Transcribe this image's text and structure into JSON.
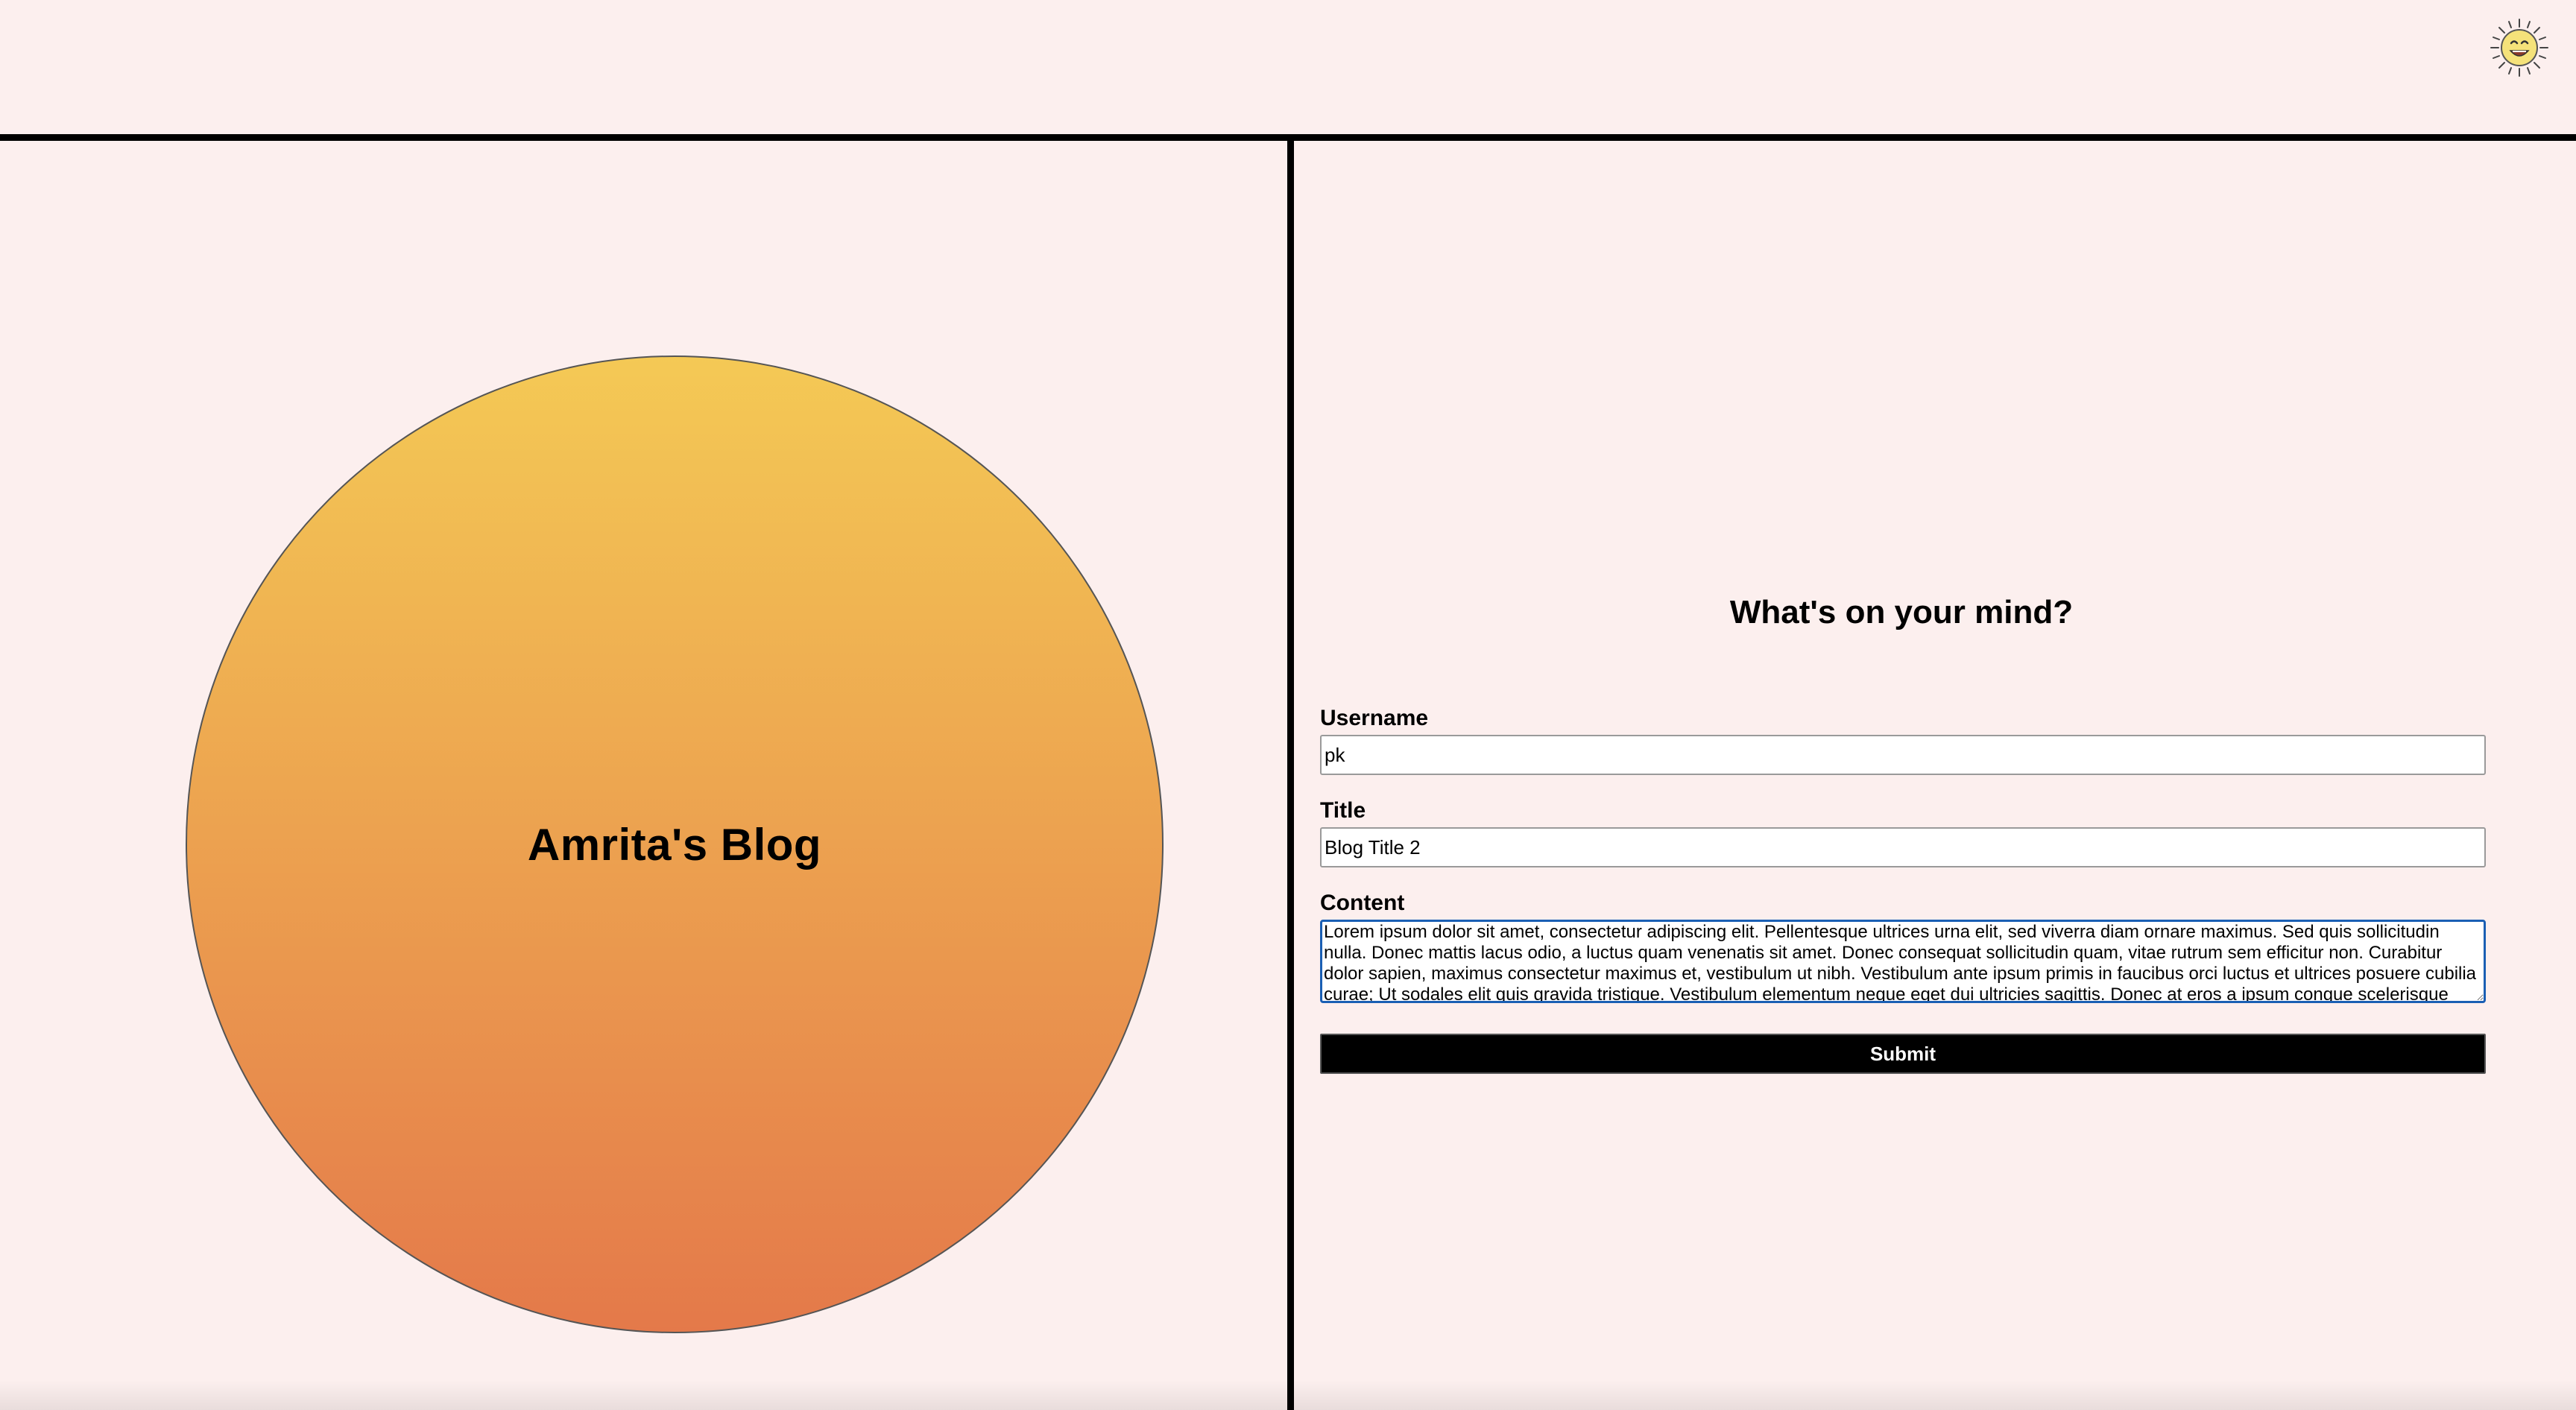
{
  "header": {
    "theme_toggle_icon": "sun-face-icon"
  },
  "hero": {
    "title": "Amrita's Blog",
    "gradient_top": "#f4c955",
    "gradient_bottom": "#e4794a"
  },
  "form": {
    "heading": "What's on your mind?",
    "username_label": "Username",
    "username_value": "pk",
    "title_label": "Title",
    "title_value": "Blog Title 2",
    "content_label": "Content",
    "content_value": "Lorem ipsum dolor sit amet, consectetur adipiscing elit. Pellentesque ultrices urna elit, sed viverra diam ornare maximus. Sed quis sollicitudin nulla. Donec mattis lacus odio, a luctus quam venenatis sit amet. Donec consequat sollicitudin quam, vitae rutrum sem efficitur non. Curabitur dolor sapien, maximus consectetur maximus et, vestibulum ut nibh. Vestibulum ante ipsum primis in faucibus orci luctus et ultrices posuere cubilia curae; Ut sodales elit quis gravida tristique. Vestibulum elementum neque eget dui ultricies sagittis. Donec at eros a ipsum congue scelerisque non",
    "submit_label": "Submit"
  },
  "colors": {
    "background": "#fcefee",
    "border": "#000000",
    "focus_border": "#1a5fb4"
  }
}
